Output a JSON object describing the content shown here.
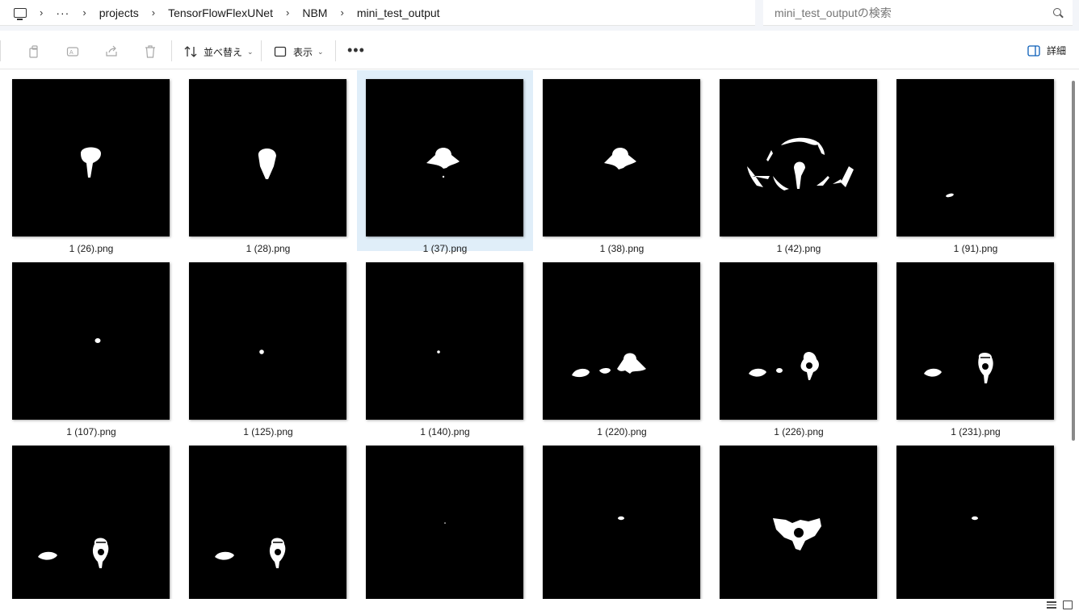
{
  "breadcrumb": {
    "more": "···",
    "items": [
      "projects",
      "TensorFlowFlexUNet",
      "NBM",
      "mini_test_output"
    ]
  },
  "search": {
    "placeholder": "mini_test_outputの検索"
  },
  "toolbar": {
    "sort_label": "並べ替え",
    "view_label": "表示",
    "more_label": "•••",
    "details_label": "詳細",
    "icons": [
      "cut-icon",
      "copy-icon",
      "rename-icon",
      "share-icon",
      "delete-icon"
    ]
  },
  "files": [
    {
      "name": "1 (26).png"
    },
    {
      "name": "1 (28).png"
    },
    {
      "name": "1 (37).png",
      "selected": true
    },
    {
      "name": "1 (38).png"
    },
    {
      "name": "1 (42).png"
    },
    {
      "name": "1 (91).png"
    },
    {
      "name": "1 (107).png"
    },
    {
      "name": "1 (125).png"
    },
    {
      "name": "1 (140).png"
    },
    {
      "name": "1 (220).png"
    },
    {
      "name": "1 (226).png"
    },
    {
      "name": "1 (231).png"
    },
    {
      "name": ""
    },
    {
      "name": ""
    },
    {
      "name": ""
    },
    {
      "name": ""
    },
    {
      "name": ""
    },
    {
      "name": ""
    }
  ],
  "colors": {
    "selection": "#e0eef9",
    "thumb_bg": "#000000",
    "mask": "#ffffff"
  }
}
